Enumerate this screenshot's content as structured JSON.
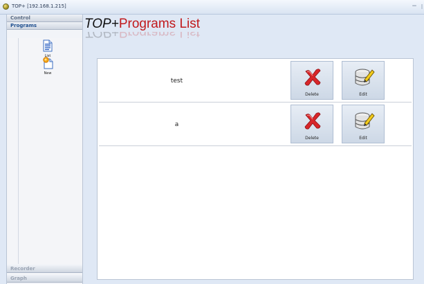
{
  "window": {
    "title": "TOP+ [192.168.1.215]",
    "minimize_symbol": "−"
  },
  "sidebar": {
    "sections": {
      "control": "Control",
      "programs": "Programs",
      "recorder": "Recorder",
      "graph": "Graph"
    },
    "active_section": "Programs",
    "items": [
      {
        "label": "List",
        "icon": "document-list-icon"
      },
      {
        "label": "New",
        "icon": "new-document-icon"
      }
    ]
  },
  "page": {
    "title_prefix": "TOP+",
    "title_main": "Programs List"
  },
  "programs": [
    {
      "name": "test",
      "delete_label": "Delete",
      "edit_label": "Edit"
    },
    {
      "name": "a",
      "delete_label": "Delete",
      "edit_label": "Edit"
    }
  ],
  "colors": {
    "title_accent": "#c1191c",
    "button_bg": "#d9e3ef",
    "delete_icon": "#d8262a",
    "edit_pencil": "#e8c31a"
  }
}
